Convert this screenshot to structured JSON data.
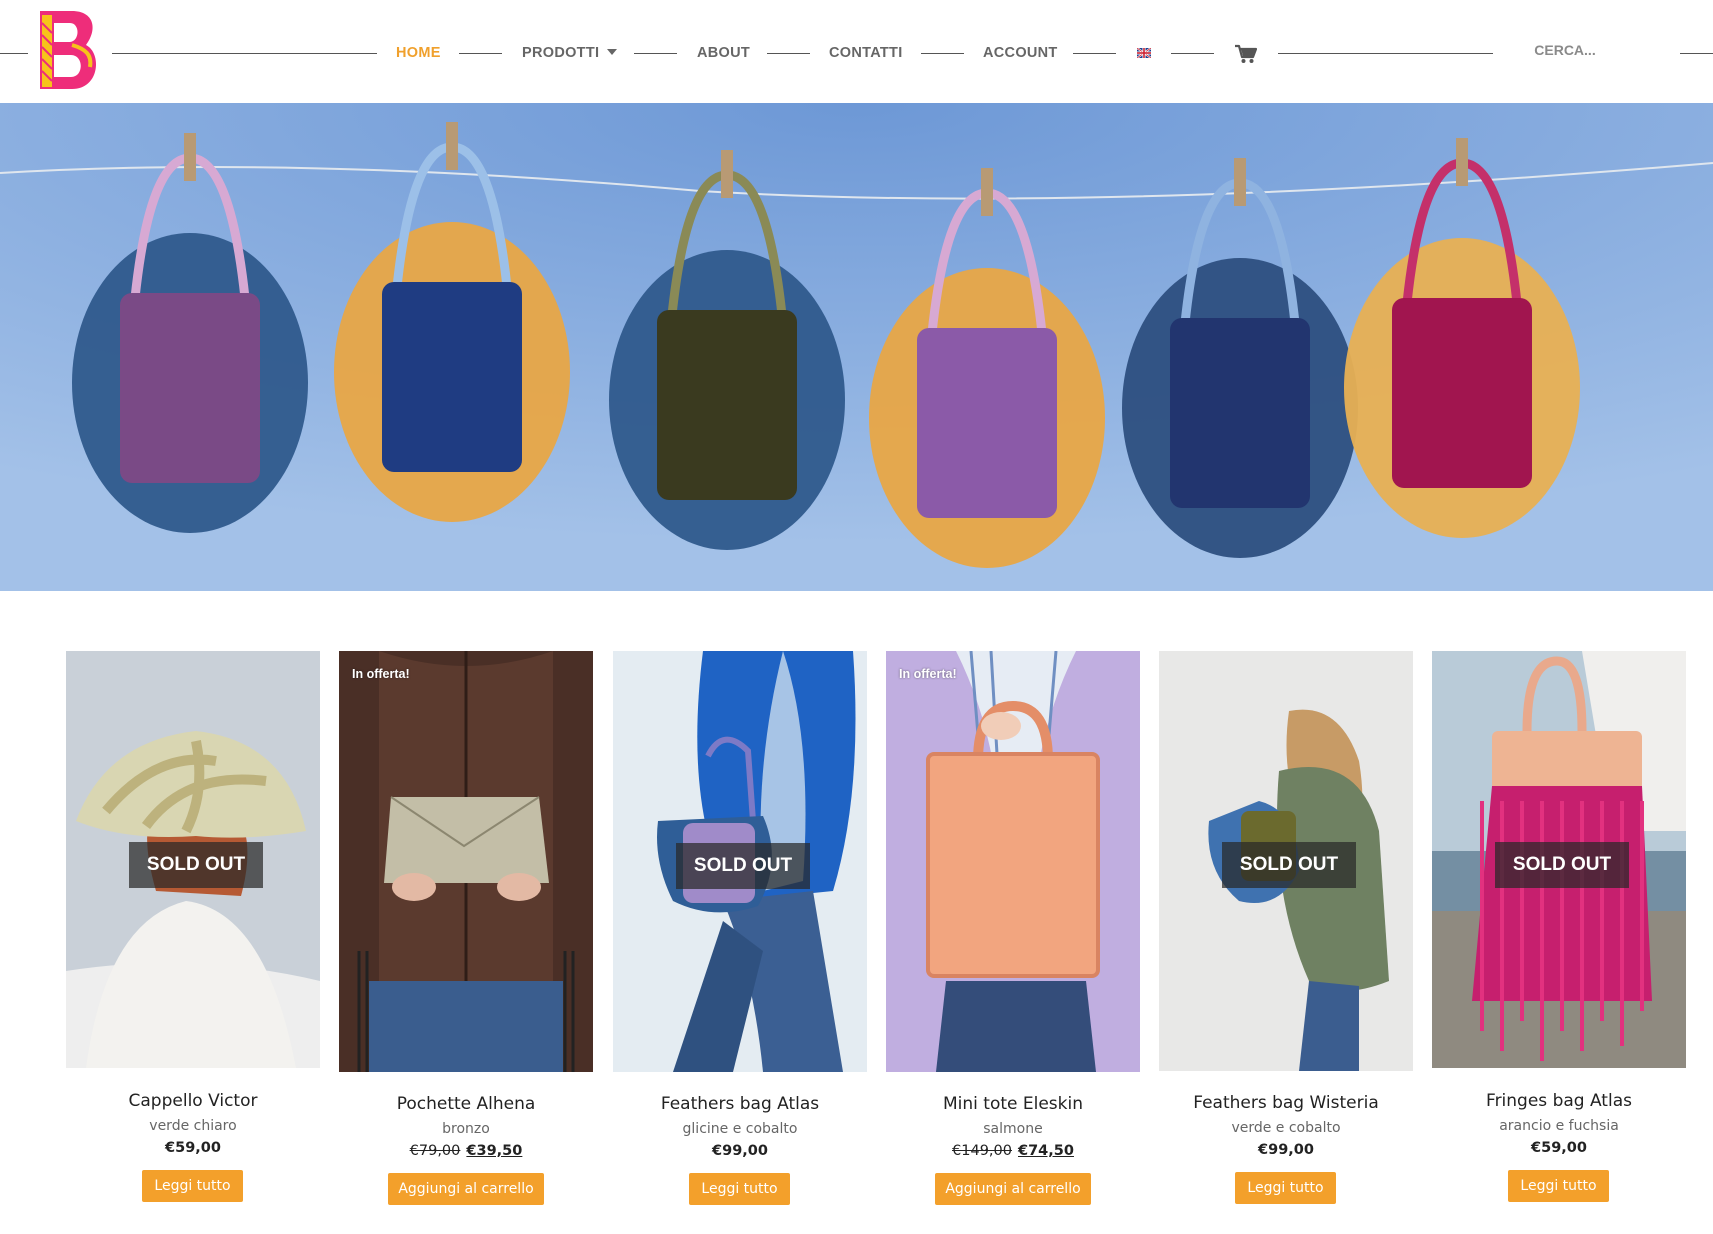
{
  "nav": {
    "items": [
      {
        "label": "HOME",
        "active": true
      },
      {
        "label": "PRODOTTI",
        "has_dropdown": true
      },
      {
        "label": "ABOUT"
      },
      {
        "label": "CONTATTI"
      },
      {
        "label": "ACCOUNT"
      }
    ],
    "language_icon": "uk-flag-icon",
    "cart_icon": "cart-icon",
    "search_placeholder": "CERCA..."
  },
  "colors": {
    "accent": "#f3a02b",
    "logo_pink": "#ee2d7a",
    "logo_yellow": "#f7c31a"
  },
  "hero": {
    "image": "six feathered bags hanging from a clothesline with pegs against a blue sky"
  },
  "products": [
    {
      "name": "Cappello Victor",
      "color": "verde chiaro",
      "price": "€59,00",
      "badge": "SOLD OUT",
      "offer": "",
      "button": "Leggi tutto"
    },
    {
      "name": "Pochette Alhena",
      "color": "bronzo",
      "old_price": "€79,00",
      "price": "€39,50",
      "badge": "",
      "offer": "In offerta!",
      "button": "Aggiungi al carrello"
    },
    {
      "name": "Feathers bag Atlas",
      "color": "glicine e cobalto",
      "price": "€99,00",
      "badge": "SOLD OUT",
      "offer": "",
      "button": "Leggi tutto"
    },
    {
      "name": "Mini tote Eleskin",
      "color": "salmone",
      "old_price": "€149,00",
      "price": "€74,50",
      "badge": "",
      "offer": "In offerta!",
      "button": "Aggiungi al carrello"
    },
    {
      "name": "Feathers bag Wisteria",
      "color": "verde e cobalto",
      "price": "€99,00",
      "badge": "SOLD OUT",
      "offer": "",
      "button": "Leggi tutto"
    },
    {
      "name": "Fringes bag Atlas",
      "color": "arancio e fuchsia",
      "price": "€59,00",
      "badge": "SOLD OUT",
      "offer": "",
      "button": "Leggi tutto"
    }
  ]
}
